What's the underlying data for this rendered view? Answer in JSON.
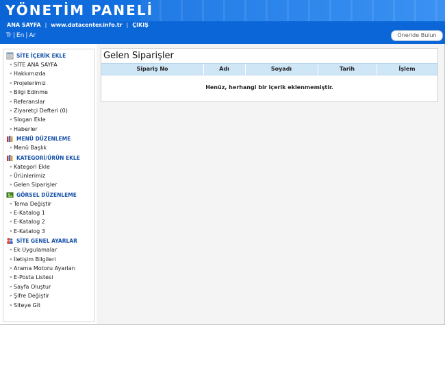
{
  "header": {
    "title": "YÖNETİM PANELİ"
  },
  "topnav": {
    "home": "ANA SAYFA",
    "site": "www.datacenter.info.tr",
    "logout": "ÇIKIŞ",
    "separator": "|"
  },
  "langbar": {
    "tr": "Tr",
    "en": "En",
    "ar": "Ar",
    "separator": "|",
    "suggest_button": "Öneride Bulun"
  },
  "sidebar": {
    "sections": [
      {
        "label": "SİTE İÇERİK EKLE",
        "icon": "notepad-icon",
        "items": [
          "SİTE ANA SAYFA",
          "Hakkımızda",
          "Projelerimiz",
          "Bilgi Edinme",
          "Referanslar",
          "Ziyaretçi Defteri (0)",
          "Slogan Ekle",
          "Haberler"
        ]
      },
      {
        "label": "MENÜ DÜZENLEME",
        "icon": "books-icon",
        "items": [
          "Menü Başlık"
        ]
      },
      {
        "label": "KATEGORİ/ÜRÜN EKLE",
        "icon": "books-icon",
        "items": [
          "Kategori Ekle",
          "Ürünlerimiz",
          "Gelen Siparişler"
        ]
      },
      {
        "label": "GÖRSEL DÜZENLEME",
        "icon": "image-icon",
        "items": [
          "Tema Değiştir",
          "E-Katalog 1",
          "E-Katalog 2",
          "E-Katalog 3"
        ]
      },
      {
        "label": "SİTE GENEL AYARLAR",
        "icon": "users-icon",
        "items": [
          "Ek Uygulamalar",
          "İletişim Bilgileri",
          "Arama Motoru Ayarları",
          "E-Posta Listesi",
          "Sayfa Oluştur",
          "Şifre Değiştir",
          "Siteye Git"
        ]
      }
    ]
  },
  "main": {
    "title": "Gelen Siparişler",
    "columns": [
      "Sipariş No",
      "Adı",
      "Soyadı",
      "Tarih",
      "İşlem"
    ],
    "empty_message": "Henüz, herhangi bir içerik eklenmemiştir."
  },
  "colors": {
    "header_blue": "#0b66d8",
    "section_label": "#1550a8",
    "table_header": "#cfe6f7"
  }
}
